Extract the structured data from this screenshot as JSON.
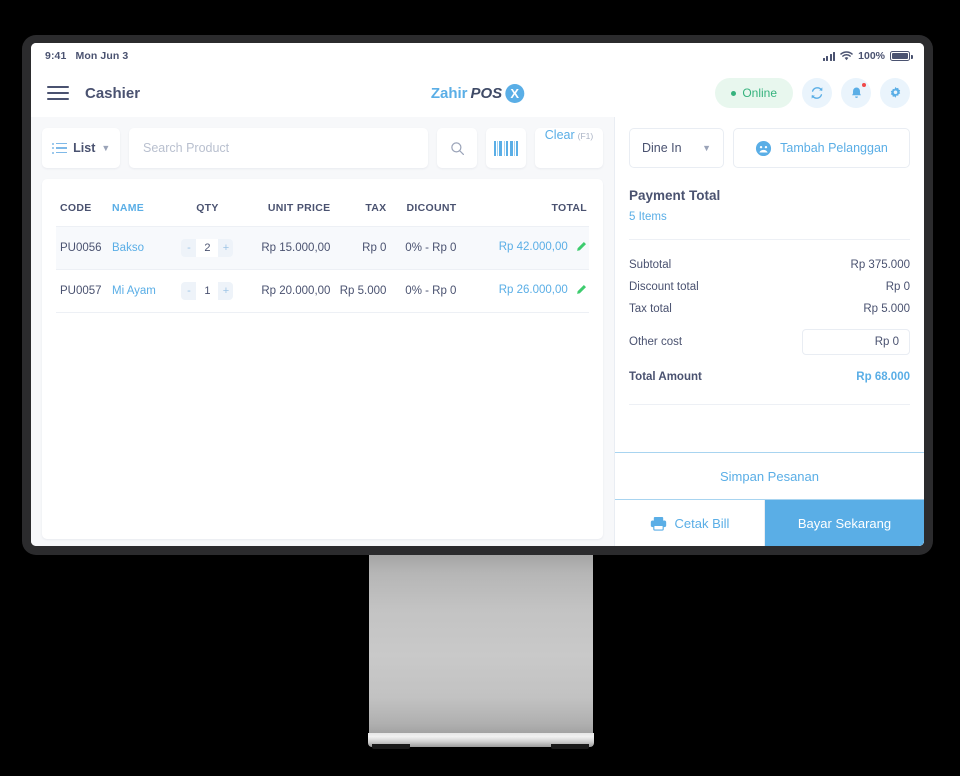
{
  "status_bar": {
    "time": "9:41",
    "date": "Mon Jun 3",
    "battery_percent": "100%",
    "signal_icon": "signal-bars-icon",
    "wifi_icon": "wifi-icon",
    "battery_icon": "battery-full-icon"
  },
  "header": {
    "menu_icon": "hamburger-menu-icon",
    "title": "Cashier",
    "logo": {
      "part1": "Zahir",
      "part2": "POS",
      "mark": "X"
    },
    "online_label": "Online",
    "sync_icon": "sync-refresh-icon",
    "bell_icon": "notification-bell-icon",
    "settings_icon": "gear-icon"
  },
  "toolbar": {
    "list_label": "List",
    "list_icon": "list-view-icon",
    "chevron_icon": "chevron-down-icon",
    "search_placeholder": "Search Product",
    "search_value": "",
    "search_icon": "search-icon",
    "barcode_icon": "barcode-scan-icon",
    "clear_label": "Clear",
    "clear_shortcut": "(F1)"
  },
  "table": {
    "columns": [
      "CODE",
      "NAME",
      "QTY",
      "UNIT PRICE",
      "TAX",
      "DICOUNT",
      "TOTAL"
    ],
    "rows": [
      {
        "code": "PU0056",
        "name": "Bakso",
        "qty": "2",
        "minus": "-",
        "plus": "+",
        "unit_price": "Rp 15.000,00",
        "tax": "Rp 0",
        "discount": "0% - Rp 0",
        "total": "Rp 42.000,00",
        "edit_icon": "pencil-edit-icon"
      },
      {
        "code": "PU0057",
        "name": "Mi Ayam",
        "qty": "1",
        "minus": "-",
        "plus": "+",
        "unit_price": "Rp 20.000,00",
        "tax": "Rp 5.000",
        "discount": "0% - Rp 0",
        "total": "Rp 26.000,00",
        "edit_icon": "pencil-edit-icon"
      }
    ]
  },
  "order_panel": {
    "order_type": "Dine In",
    "order_type_chevron": "chevron-down-icon",
    "add_customer_label": "Tambah Pelanggan",
    "add_customer_icon": "customer-face-icon",
    "payment_title": "Payment Total",
    "items_count": "5 Items",
    "summary": [
      {
        "label": "Subtotal",
        "value": "Rp 375.000"
      },
      {
        "label": "Discount total",
        "value": "Rp 0"
      },
      {
        "label": "Tax total",
        "value": "Rp 5.000"
      }
    ],
    "other_cost_label": "Other cost",
    "other_cost_value": "Rp 0",
    "total_label": "Total Amount",
    "total_value": "Rp 68.000",
    "save_order_label": "Simpan Pesanan",
    "print_bill_label": "Cetak Bill",
    "print_icon": "printer-icon",
    "pay_now_label": "Bayar Sekarang"
  },
  "colors": {
    "accent": "#5aaee6",
    "text": "#4a5270",
    "online": "#36b37e",
    "badge": "#f04a4a",
    "edit": "#3dcc6e"
  }
}
